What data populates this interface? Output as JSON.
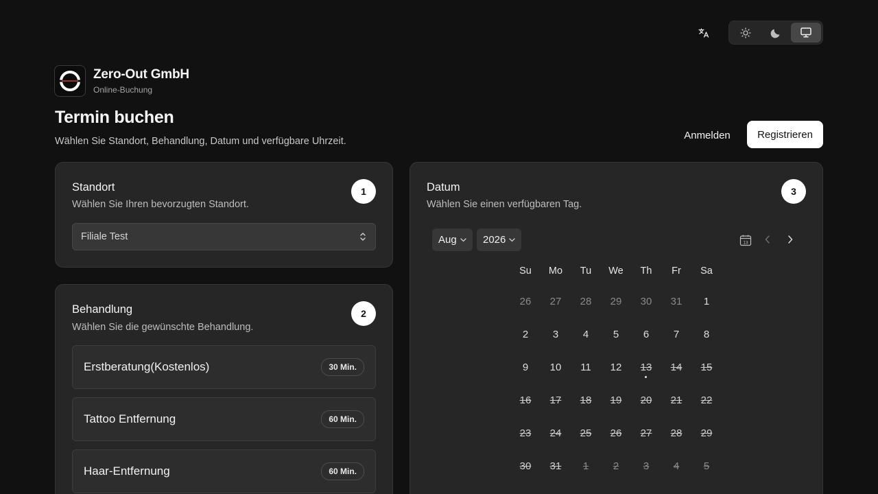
{
  "toolbar": {
    "language_icon": "translate-icon",
    "theme_options": [
      {
        "name": "light",
        "icon": "sun-icon",
        "active": false
      },
      {
        "name": "dark",
        "icon": "moon-icon",
        "active": false
      },
      {
        "name": "system",
        "icon": "monitor-icon",
        "active": true
      }
    ]
  },
  "brand": {
    "name": "Zero-Out GmbH",
    "subtitle": "Online-Buchung"
  },
  "page": {
    "title": "Termin buchen",
    "subtitle": "Wählen Sie Standort, Behandlung, Datum und verfügbare Uhrzeit."
  },
  "auth": {
    "login_label": "Anmelden",
    "register_label": "Registrieren"
  },
  "location": {
    "title": "Standort",
    "description": "Wählen Sie Ihren bevorzugten Standort.",
    "step": "1",
    "selected": "Filiale Test"
  },
  "treatment": {
    "title": "Behandlung",
    "description": "Wählen Sie die gewünschte Behandlung.",
    "step": "2",
    "items": [
      {
        "name": "Erstberatung(Kostenlos)",
        "duration": "30 Min."
      },
      {
        "name": "Tattoo Entfernung",
        "duration": "60 Min."
      },
      {
        "name": "Haar-Entfernung",
        "duration": "60 Min."
      }
    ]
  },
  "date": {
    "title": "Datum",
    "description": "Wählen Sie einen verfügbaren Tag.",
    "step": "3",
    "month": "Aug",
    "year": "2026",
    "weekdays": [
      "Su",
      "Mo",
      "Tu",
      "We",
      "Th",
      "Fr",
      "Sa"
    ],
    "weeks": [
      [
        {
          "d": "26",
          "s": "out"
        },
        {
          "d": "27",
          "s": "out"
        },
        {
          "d": "28",
          "s": "out"
        },
        {
          "d": "29",
          "s": "out"
        },
        {
          "d": "30",
          "s": "out"
        },
        {
          "d": "31",
          "s": "out"
        },
        {
          "d": "1",
          "s": "avail"
        }
      ],
      [
        {
          "d": "2",
          "s": "avail"
        },
        {
          "d": "3",
          "s": "avail"
        },
        {
          "d": "4",
          "s": "avail"
        },
        {
          "d": "5",
          "s": "avail"
        },
        {
          "d": "6",
          "s": "avail"
        },
        {
          "d": "7",
          "s": "avail"
        },
        {
          "d": "8",
          "s": "avail"
        }
      ],
      [
        {
          "d": "9",
          "s": "avail"
        },
        {
          "d": "10",
          "s": "avail"
        },
        {
          "d": "11",
          "s": "avail"
        },
        {
          "d": "12",
          "s": "avail"
        },
        {
          "d": "13",
          "s": "dis",
          "today": true
        },
        {
          "d": "14",
          "s": "dis"
        },
        {
          "d": "15",
          "s": "dis"
        }
      ],
      [
        {
          "d": "16",
          "s": "dis"
        },
        {
          "d": "17",
          "s": "dis"
        },
        {
          "d": "18",
          "s": "dis"
        },
        {
          "d": "19",
          "s": "dis"
        },
        {
          "d": "20",
          "s": "dis"
        },
        {
          "d": "21",
          "s": "dis"
        },
        {
          "d": "22",
          "s": "dis"
        }
      ],
      [
        {
          "d": "23",
          "s": "dis"
        },
        {
          "d": "24",
          "s": "dis"
        },
        {
          "d": "25",
          "s": "dis"
        },
        {
          "d": "26",
          "s": "dis"
        },
        {
          "d": "27",
          "s": "dis"
        },
        {
          "d": "28",
          "s": "dis"
        },
        {
          "d": "29",
          "s": "dis"
        }
      ],
      [
        {
          "d": "30",
          "s": "dis"
        },
        {
          "d": "31",
          "s": "dis"
        },
        {
          "d": "1",
          "s": "dis out"
        },
        {
          "d": "2",
          "s": "dis out"
        },
        {
          "d": "3",
          "s": "dis out"
        },
        {
          "d": "4",
          "s": "dis out"
        },
        {
          "d": "5",
          "s": "dis out"
        }
      ]
    ],
    "calendar_icon_label": "13"
  }
}
